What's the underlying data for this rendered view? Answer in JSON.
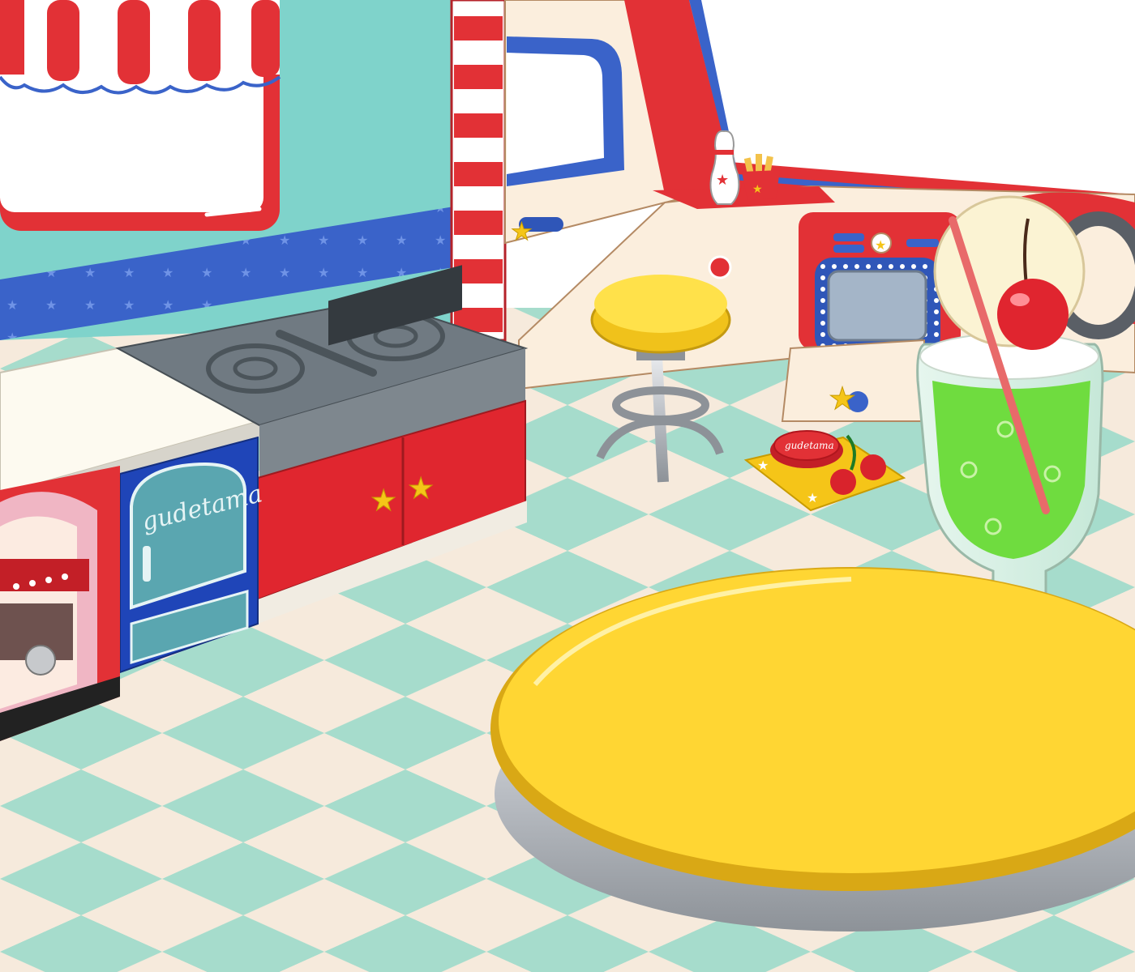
{
  "scene": {
    "oven_brand": "gudetama",
    "cap_brand": "gudetama"
  },
  "colors": {
    "floor_mint": "#a6dccc",
    "floor_cream": "#f6eadc",
    "wall_teal": "#7fd3cb",
    "stripe_red": "#e23136",
    "stripe_blue": "#3a63c9",
    "counter_red": "#e0262f",
    "table_yellow": "#ffd633",
    "soda_green": "#6fdc3f",
    "wall_cream": "#fbeedd"
  },
  "icons": {
    "stars": "star-icon",
    "cherry": "cherry-icon",
    "bowling_pin": "bowling-pin-icon",
    "fries": "fries-icon"
  }
}
